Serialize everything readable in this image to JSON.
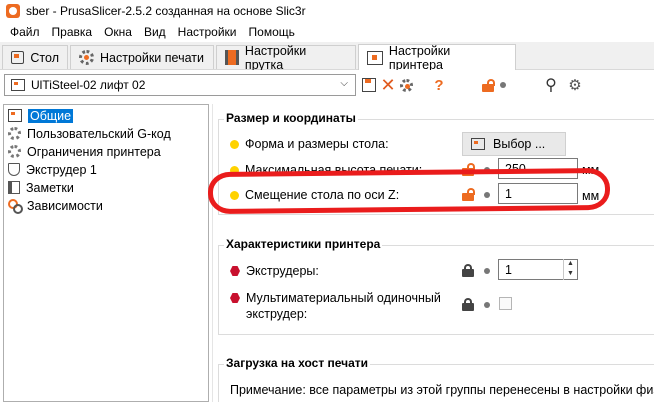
{
  "window": {
    "title": "sber - PrusaSlicer-2.5.2 созданная на основе Slic3r"
  },
  "menu": [
    "Файл",
    "Правка",
    "Окна",
    "Вид",
    "Настройки",
    "Помощь"
  ],
  "tabs": [
    {
      "label": "Стол",
      "icon": "plater-icon",
      "active": false
    },
    {
      "label": "Настройки печати",
      "icon": "gear-icon",
      "active": false
    },
    {
      "label": "Настройки прутка",
      "icon": "spool-icon",
      "active": false
    },
    {
      "label": "Настройки принтера",
      "icon": "printer-icon",
      "active": true
    }
  ],
  "preset": {
    "selected": "UlTiSteel-02 лифт 02",
    "toolbar_icons": [
      "save-icon",
      "delete-icon",
      "compare-icon",
      "help-icon",
      "lock-icon",
      "dot-icon",
      "search-icon",
      "settings-icon"
    ],
    "help_glyph": "?"
  },
  "sidebar": {
    "items": [
      {
        "label": "Общие",
        "icon": "general-icon",
        "selected": true
      },
      {
        "label": "Пользовательский G-код",
        "icon": "gcode-gear-icon",
        "selected": false
      },
      {
        "label": "Ограничения принтера",
        "icon": "limits-gear-icon",
        "selected": false
      },
      {
        "label": "Экструдер 1",
        "icon": "extruder-icon",
        "selected": false
      },
      {
        "label": "Заметки",
        "icon": "notes-icon",
        "selected": false
      },
      {
        "label": "Зависимости",
        "icon": "dependencies-icon",
        "selected": false
      }
    ]
  },
  "groups": {
    "size": {
      "title": "Размер и координаты",
      "bed_shape_label": "Форма и размеры стола:",
      "bed_shape_button": "Выбор ...",
      "max_height_label": "Максимальная высота печати:",
      "max_height_value": "250",
      "max_height_unit": "мм",
      "z_offset_label": "Смещение стола по оси Z:",
      "z_offset_value": "1",
      "z_offset_unit": "мм"
    },
    "printer": {
      "title": "Характеристики принтера",
      "extruders_label": "Экструдеры:",
      "extruders_value": "1",
      "mm_label_line1": "Мультиматериальный одиночный",
      "mm_label_line2": "экструдер:"
    },
    "host": {
      "title": "Загрузка на хост печати",
      "note": "Примечание: все параметры из этой группы перенесены в настройки физи"
    }
  },
  "colors": {
    "accent": "#ed6b21",
    "selection": "#0078d7",
    "simple_mode": "#ffd200",
    "expert_mode": "#c8102e",
    "annotation": "#ea1c1c"
  }
}
